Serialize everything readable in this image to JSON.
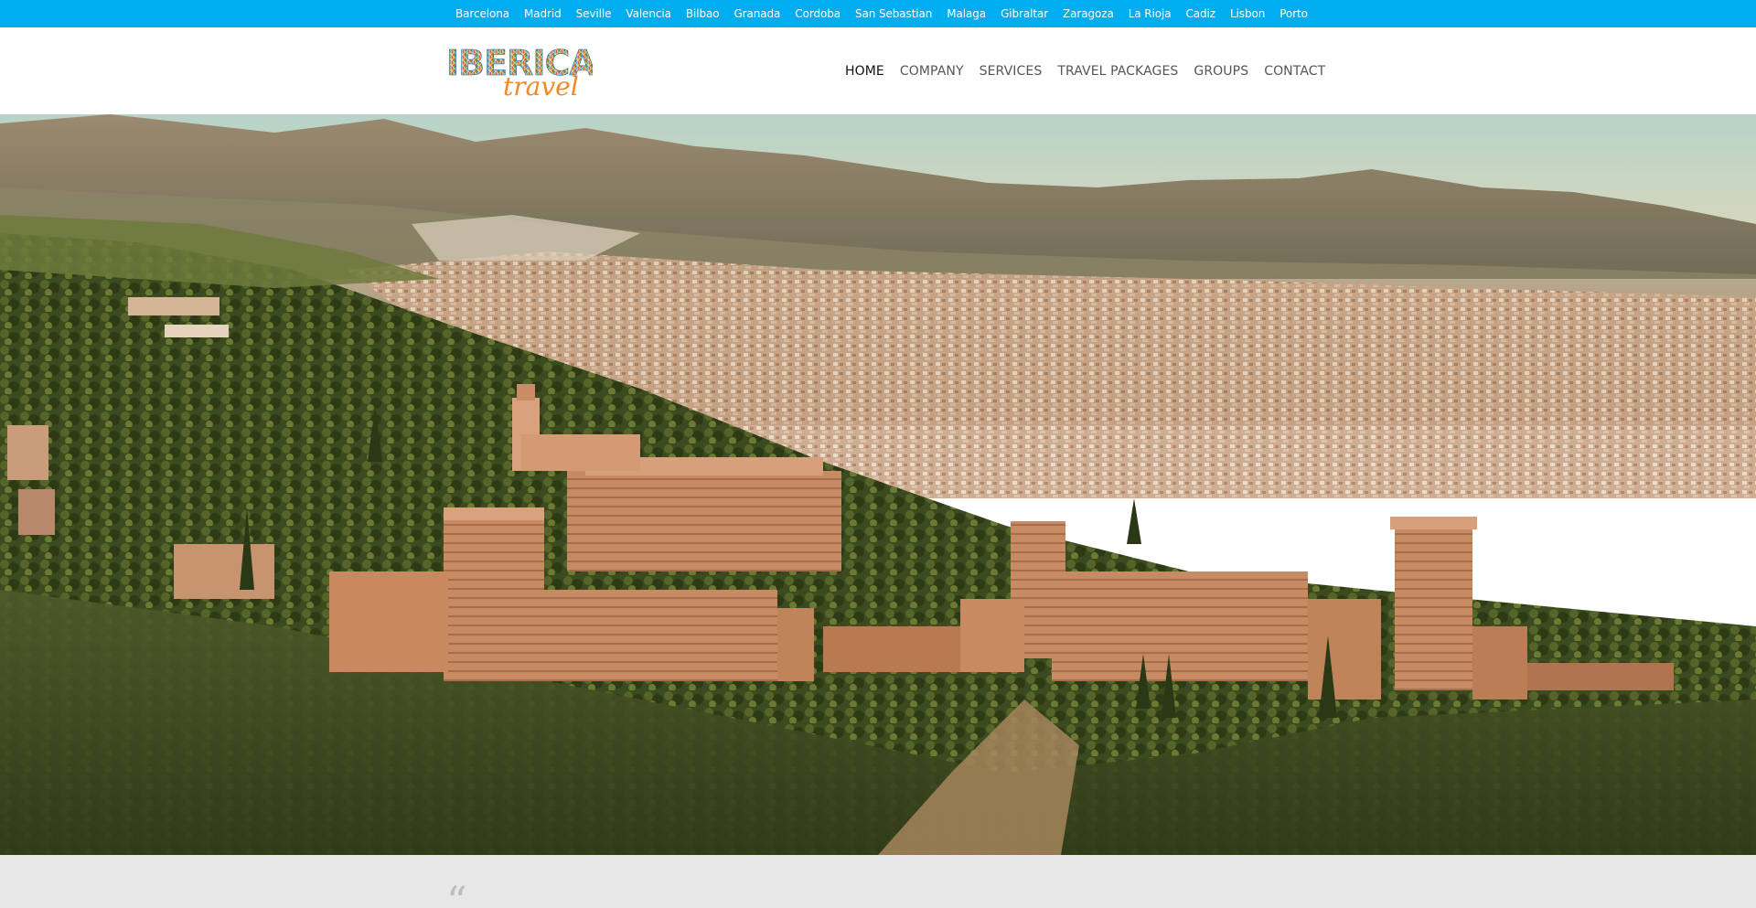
{
  "city_bar": {
    "cities": [
      "Barcelona",
      "Madrid",
      "Seville",
      "Valencia",
      "Bilbao",
      "Granada",
      "Cordoba",
      "San Sebastian",
      "Malaga",
      "Gibraltar",
      "Zaragoza",
      "La Rioja",
      "Cadiz",
      "Lisbon",
      "Porto"
    ],
    "background": "#00adee"
  },
  "logo": {
    "word_top": "IBERICA",
    "word_bottom": "travel",
    "accent_color": "#f08a24"
  },
  "nav": {
    "items": [
      "HOME",
      "COMPANY",
      "SERVICES",
      "TRAVEL PACKAGES",
      "GROUPS",
      "CONTACT"
    ],
    "active": "HOME"
  },
  "hero": {
    "image": "aerial-fortress-city-photo"
  },
  "quote": {
    "mark": "“"
  }
}
